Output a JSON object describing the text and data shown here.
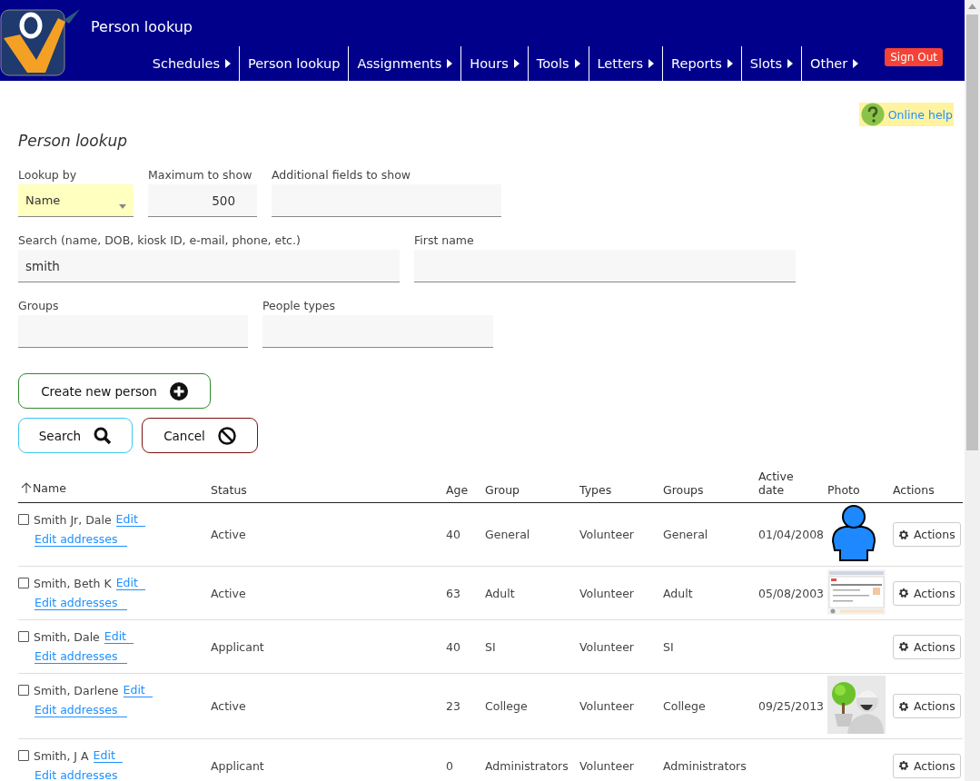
{
  "header": {
    "title": "Person lookup",
    "menu": [
      {
        "label": "Schedules",
        "submenu": true
      },
      {
        "label": "Person lookup",
        "submenu": false
      },
      {
        "label": "Assignments",
        "submenu": true
      },
      {
        "label": "Hours",
        "submenu": true
      },
      {
        "label": "Tools",
        "submenu": true
      },
      {
        "label": "Letters",
        "submenu": true
      },
      {
        "label": "Reports",
        "submenu": true
      },
      {
        "label": "Slots",
        "submenu": true
      },
      {
        "label": "Other",
        "submenu": true
      }
    ],
    "sign_out": "Sign Out"
  },
  "help_link": "Online help",
  "page_title": "Person lookup",
  "form": {
    "lookup_by": {
      "label": "Lookup by",
      "value": "Name"
    },
    "maximum": {
      "label": "Maximum to show",
      "value": "500"
    },
    "additional_fields": {
      "label": "Additional fields to show"
    },
    "search": {
      "label": "Search (name, DOB, kiosk ID, e-mail, phone, etc.)",
      "value": "smith"
    },
    "first_name": {
      "label": "First name"
    },
    "groups": {
      "label": "Groups"
    },
    "people_types": {
      "label": "People types"
    }
  },
  "buttons": {
    "create": "Create new person",
    "search": "Search",
    "cancel": "Cancel"
  },
  "table": {
    "columns": [
      "Name",
      "Status",
      "Age",
      "Group",
      "Types",
      "Groups",
      "Active date",
      "Photo",
      "Actions"
    ],
    "rows": [
      {
        "name": "Smith Jr, Dale",
        "edit": "Edit",
        "edit_addresses": "Edit addresses",
        "checked": false,
        "status": "Active",
        "age": "40",
        "group": "General",
        "types": "Volunteer",
        "groups": "General",
        "active_date": "01/04/2008",
        "photo": {
          "kind": "avatar"
        },
        "action": "Actions"
      },
      {
        "name": "Smith, Beth K",
        "edit": "Edit",
        "edit_addresses": "Edit addresses",
        "checked": false,
        "status": "Active",
        "age": "63",
        "group": "Adult",
        "types": "Volunteer",
        "groups": "Adult",
        "active_date": "05/08/2003",
        "photo": {
          "kind": "screenshot"
        },
        "action": "Actions"
      },
      {
        "name": "Smith, Dale",
        "edit": "Edit",
        "edit_addresses": "Edit addresses",
        "checked": false,
        "status": "Applicant",
        "age": "40",
        "group": "SI",
        "types": "Volunteer",
        "groups": "SI",
        "action": "Actions"
      },
      {
        "name": "Smith, Darlene",
        "edit": "Edit",
        "edit_addresses": "Edit addresses",
        "checked": false,
        "status": "Active",
        "age": "23",
        "group": "College",
        "types": "Volunteer",
        "groups": "College",
        "active_date": "09/25/2013",
        "action": "Actions"
      },
      {
        "name": "Smith, J A",
        "edit": "Edit",
        "edit_addresses": "Edit addresses",
        "checked": false,
        "status": "Applicant",
        "age": "0",
        "group": "Administrators",
        "types": "Volunteer",
        "groups": "Administrators",
        "action": "Actions"
      }
    ]
  }
}
